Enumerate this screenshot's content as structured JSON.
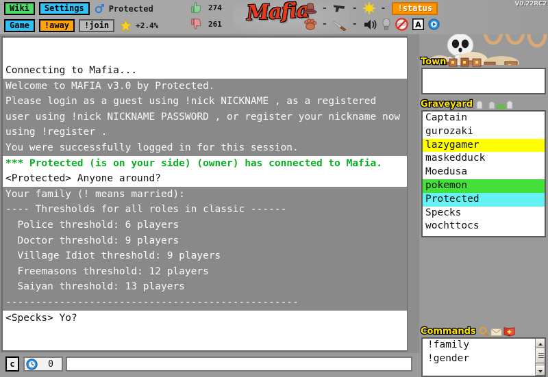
{
  "app": {
    "title": "Mafia",
    "version": "V0.22RC2",
    "logo_color": "#e8391b"
  },
  "topbar": {
    "buttons": [
      {
        "name": "wiki",
        "label": "Wiki",
        "color": "#4ddd6b"
      },
      {
        "name": "settings",
        "label": "Settings",
        "color": "#2ec2f6"
      },
      {
        "name": "game",
        "label": "Game",
        "color": "#2ec2f6"
      },
      {
        "name": "away",
        "label": "!away",
        "color": "#ffa408"
      },
      {
        "name": "join",
        "label": "!join",
        "color": "#b9b9b9"
      },
      {
        "name": "status",
        "label": "!status",
        "color": "#ff9400"
      }
    ],
    "nickname": "Protected",
    "gender_icon": "male-gender-icon",
    "rank_icon": "star-icon",
    "rank_value": "+2.4%",
    "thumbs_up_icon": "thumbs-up-icon",
    "thumbs_up_count": "274",
    "thumbs_down_icon": "thumbs-down-icon",
    "thumbs_down_count": "261",
    "role_icons": [
      {
        "name": "top-hat-icon",
        "value": "-"
      },
      {
        "name": "gun-icon",
        "value": "-"
      },
      {
        "name": "sun-icon",
        "value": "-"
      },
      {
        "name": "cat-paw-icon",
        "value": "-"
      },
      {
        "name": "knife-icon",
        "value": "-"
      }
    ],
    "toggle_icons": [
      "speaker-icon",
      "lightbulb-icon",
      "no-smoking-icon",
      "afk-letter-icon",
      "play-button-icon"
    ]
  },
  "chat": {
    "lines": [
      {
        "text": "Connecting to Mafia...",
        "style": "white"
      },
      {
        "text": "Welcome to MAFIA v3.0 by Protected.",
        "style": "gray"
      },
      {
        "text": "Please login as a guest using !nick NICKNAME , as a registered user using !nick NICKNAME PASSWORD , or register your nickname now using !register .",
        "style": "gray"
      },
      {
        "text": "You were successfully logged in for this session.",
        "style": "gray"
      },
      {
        "text": "*** Protected (is on your side) (owner) has connected to Mafia.",
        "style": "green"
      },
      {
        "text": "<Protected> Anyone around?",
        "style": "white"
      },
      {
        "text": "Your family (! means married):",
        "style": "gray"
      },
      {
        "text": "---- Thresholds for all roles in classic ------",
        "style": "gray"
      },
      {
        "text": "  Police threshold: 6 players",
        "style": "gray"
      },
      {
        "text": "  Doctor threshold: 9 players",
        "style": "gray"
      },
      {
        "text": "  Village Idiot threshold: 9 players",
        "style": "gray"
      },
      {
        "text": "  Freemasons threshold: 12 players",
        "style": "gray"
      },
      {
        "text": "  Saiyan threshold: 13 players",
        "style": "gray"
      },
      {
        "text": "-------------------------------------------------",
        "style": "gray"
      },
      {
        "text": "<Specks> Yo?",
        "style": "white"
      }
    ]
  },
  "sidebar": {
    "town": {
      "label": "Town",
      "icon": "town-houses-icon",
      "players": []
    },
    "graveyard": {
      "label": "Graveyard",
      "icon": "tombstone-icon",
      "players": [
        {
          "name": "Captain",
          "highlight": "none"
        },
        {
          "name": "gurozaki",
          "highlight": "none"
        },
        {
          "name": "lazygamer",
          "highlight": "yellow"
        },
        {
          "name": "maskedduck",
          "highlight": "none"
        },
        {
          "name": "Moedusa",
          "highlight": "none"
        },
        {
          "name": "pokemon",
          "highlight": "green"
        },
        {
          "name": "Protected",
          "highlight": "cyan"
        },
        {
          "name": "Specks",
          "highlight": "none"
        },
        {
          "name": "wochttocs",
          "highlight": "none"
        }
      ]
    },
    "commands": {
      "label": "Commands",
      "icons": [
        "magnifier-icon",
        "envelope-icon",
        "book-icon"
      ],
      "items": [
        "!family",
        "!gender"
      ]
    },
    "art": {
      "skull_icon": "skull-and-crossbones-icon",
      "noose_icon": "hangman-noose-icon",
      "noose_count": 3
    }
  },
  "bottombar": {
    "clear_button_label": "c",
    "timer_icon": "clock-icon",
    "timer_value": "0",
    "message_input_value": "",
    "message_input_placeholder": ""
  },
  "colors": {
    "highlight_yellow": "#ffff00",
    "highlight_green": "#44e03a",
    "highlight_cyan": "#66f2f2",
    "label_yellow": "#ffe400",
    "chat_green": "#0aae22",
    "chat_gray_bg": "#898989"
  }
}
